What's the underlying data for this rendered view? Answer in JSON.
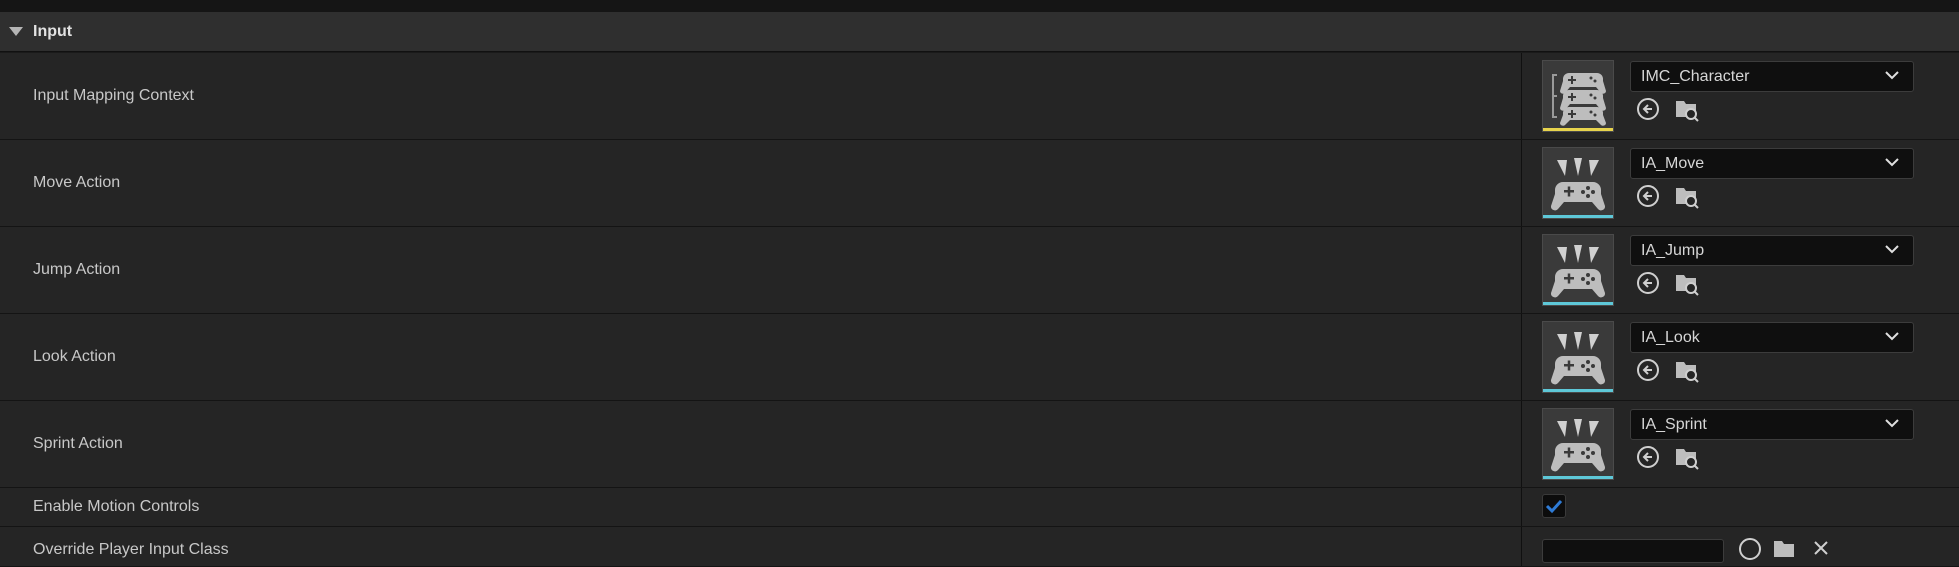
{
  "section": {
    "title": "Input"
  },
  "rows": [
    {
      "label": "Input Mapping Context",
      "value": "IMC_Character",
      "asset_type": "input-mapping-context",
      "accent": "#e8d44d"
    },
    {
      "label": "Move Action",
      "value": "IA_Move",
      "asset_type": "input-action",
      "accent": "#5ec8d8"
    },
    {
      "label": "Jump Action",
      "value": "IA_Jump",
      "asset_type": "input-action",
      "accent": "#5ec8d8"
    },
    {
      "label": "Look Action",
      "value": "IA_Look",
      "asset_type": "input-action",
      "accent": "#5ec8d8"
    },
    {
      "label": "Sprint Action",
      "value": "IA_Sprint",
      "asset_type": "input-action",
      "accent": "#5ec8d8"
    }
  ],
  "motion_controls": {
    "label": "Enable Motion Controls",
    "checked": true
  },
  "partial_row": {
    "label": "Override Player Input Class"
  },
  "icons": {
    "use_selected": "arrow-left-circle-icon",
    "browse": "folder-search-icon",
    "dropdown": "chevron-down-icon",
    "collapse": "caret-down-icon"
  },
  "colors": {
    "checkbox_accent": "#2e7bd6"
  }
}
